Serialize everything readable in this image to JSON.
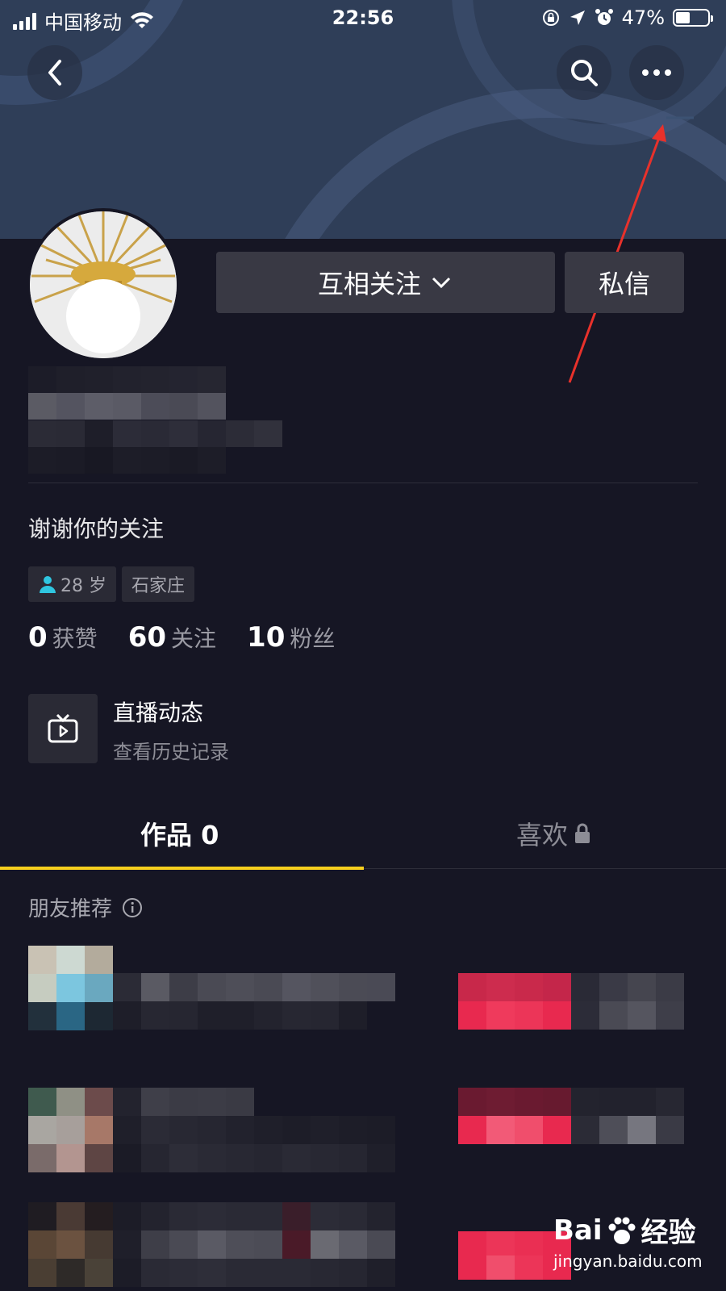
{
  "status_bar": {
    "carrier": "中国移动",
    "time": "22:56",
    "battery_pct": "47%"
  },
  "profile": {
    "follow_button": "互相关注",
    "message_button": "私信",
    "bio": "谢谢你的关注",
    "tags": [
      {
        "icon": "person-icon",
        "label": "28 岁"
      },
      {
        "label": "石家庄"
      }
    ],
    "stats": [
      {
        "num": "0",
        "label": "获赞"
      },
      {
        "num": "60",
        "label": "关注"
      },
      {
        "num": "10",
        "label": "粉丝"
      }
    ]
  },
  "live": {
    "title": "直播动态",
    "subtitle": "查看历史记录"
  },
  "tabs": [
    {
      "label": "作品 0",
      "active": true
    },
    {
      "label": "喜欢",
      "locked": true
    }
  ],
  "recommend": {
    "title": "朋友推荐"
  },
  "watermark": {
    "brand": "Bai",
    "suffix": "经验",
    "url": "jingyan.baidu.com"
  },
  "colors": {
    "background": "#161624",
    "accent": "#f8cf1e",
    "banner": "#2f3e58",
    "annotation": "#e8312b",
    "recommend_button": "#e8294f"
  }
}
